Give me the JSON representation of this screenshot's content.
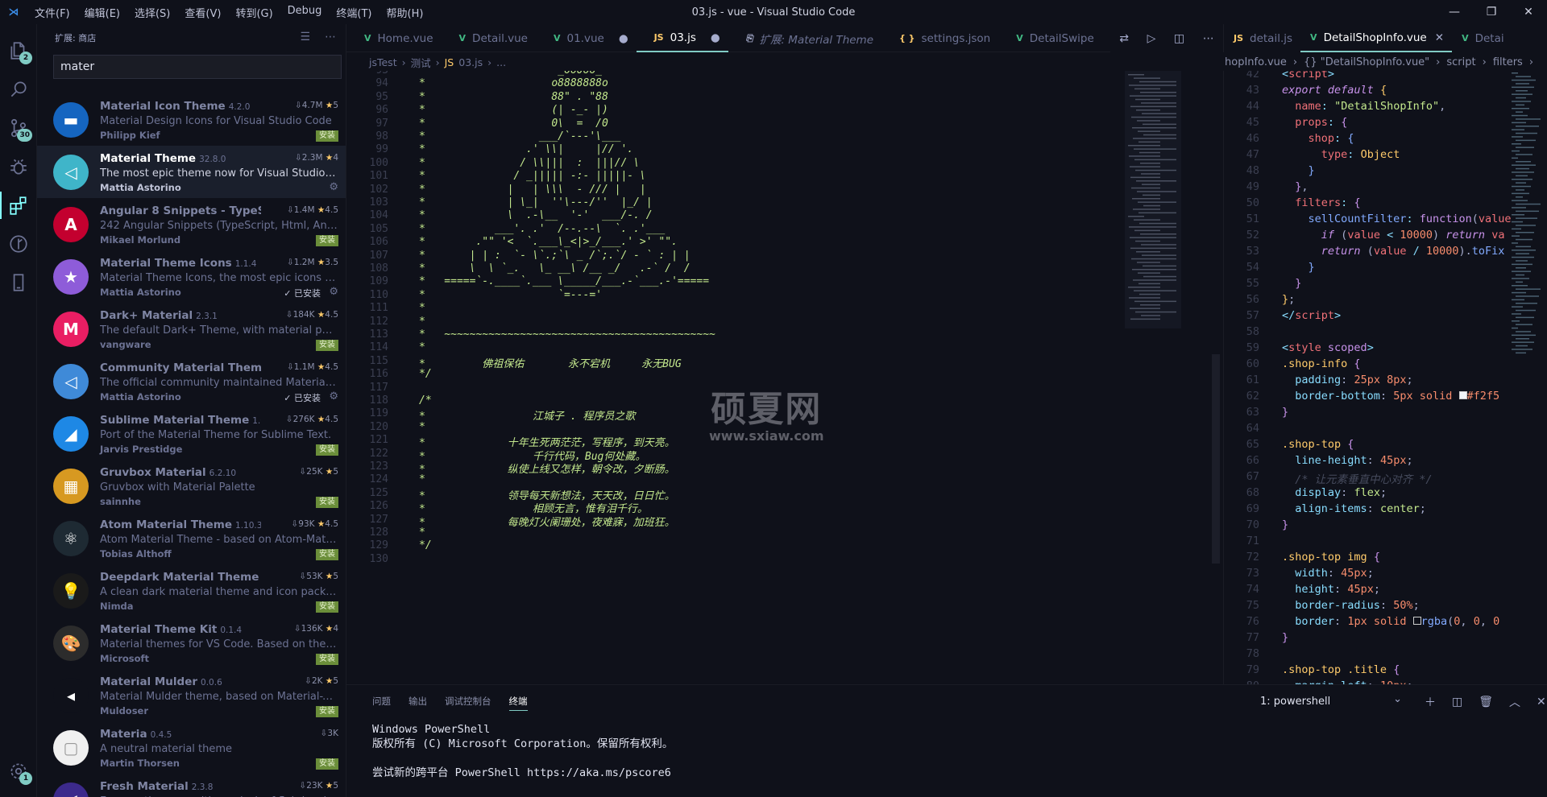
{
  "window": {
    "title": "03.js - vue - Visual Studio Code",
    "menu": [
      "文件(F)",
      "编辑(E)",
      "选择(S)",
      "查看(V)",
      "转到(G)",
      "Debug",
      "终端(T)",
      "帮助(H)"
    ],
    "controls": [
      "—",
      "❐",
      "✕"
    ]
  },
  "activity": {
    "explorer_badge": "2",
    "scm_badge": "30",
    "accounts_badge": "1"
  },
  "sidebar": {
    "title": "扩展: 商店",
    "search_value": "mater",
    "extensions": [
      {
        "name": "Material Icon Theme",
        "version": "4.2.0",
        "downloads": "4.7M",
        "rating": "5",
        "desc": "Material Design Icons for Visual Studio Code",
        "publisher": "Philipp Kief",
        "status": "安装",
        "icon_color": "#1565c0",
        "icon_glyph": "▬"
      },
      {
        "name": "Material Theme",
        "version": "32.8.0",
        "downloads": "2.3M",
        "rating": "4",
        "desc": "The most epic theme now for Visual Studio Code",
        "publisher": "Mattia Astorino",
        "status": "gear",
        "icon_color": "#3fb5c9",
        "icon_glyph": "◁"
      },
      {
        "name": "Angular 8 Snippets - TypeScr...",
        "version": "8.1.2",
        "downloads": "1.4M",
        "rating": "4.5",
        "desc": "242 Angular Snippets (TypeScript, Html, Angular ...",
        "publisher": "Mikael Morlund",
        "status": "安装",
        "icon_color": "#c3002f",
        "icon_glyph": "A"
      },
      {
        "name": "Material Theme Icons",
        "version": "1.1.4",
        "downloads": "1.2M",
        "rating": "3.5",
        "desc": "Material Theme Icons, the most epic icons theme...",
        "publisher": "Mattia Astorino",
        "status": "✓ 已安装",
        "icon_color": "#8e5cd9",
        "icon_glyph": "★"
      },
      {
        "name": "Dark+ Material",
        "version": "2.3.1",
        "downloads": "184K",
        "rating": "4.5",
        "desc": "The default Dark+ Theme, with material palette a...",
        "publisher": "vangware",
        "status": "安装",
        "icon_color": "#e91e63",
        "icon_glyph": "M"
      },
      {
        "name": "Community Material Theme",
        "version": "1.4.1",
        "downloads": "1.1M",
        "rating": "4.5",
        "desc": "The official community maintained Material The...",
        "publisher": "Mattia Astorino",
        "status": "✓ 已安装",
        "icon_color": "#3f8ad8",
        "icon_glyph": "◁"
      },
      {
        "name": "Sublime Material Theme",
        "version": "1.0.1",
        "downloads": "276K",
        "rating": "4.5",
        "desc": "Port of the Material Theme for Sublime Text.",
        "publisher": "Jarvis Prestidge",
        "status": "安装",
        "icon_color": "#1e88e5",
        "icon_glyph": "◢"
      },
      {
        "name": "Gruvbox Material",
        "version": "6.2.10",
        "downloads": "25K",
        "rating": "5",
        "desc": "Gruvbox with Material Palette",
        "publisher": "sainnhe",
        "status": "安装",
        "icon_color": "#d79921",
        "icon_glyph": "▦"
      },
      {
        "name": "Atom Material Theme",
        "version": "1.10.3",
        "downloads": "93K",
        "rating": "4.5",
        "desc": "Atom Material Theme - based on Atom-Material-...",
        "publisher": "Tobias Althoff",
        "status": "安装",
        "icon_color": "#1e2a33",
        "icon_glyph": "⚛"
      },
      {
        "name": "Deepdark Material Theme",
        "version": "3.2.1",
        "downloads": "53K",
        "rating": "5",
        "desc": "A clean dark material theme and icon package fo...",
        "publisher": "Nimda",
        "status": "安装",
        "icon_color": "#1a1a1a",
        "icon_glyph": "💡"
      },
      {
        "name": "Material Theme Kit",
        "version": "0.1.4",
        "downloads": "136K",
        "rating": "4",
        "desc": "Material themes for VS Code. Based on the Text...",
        "publisher": "Microsoft",
        "status": "安装",
        "icon_color": "#2c2c2c",
        "icon_glyph": "🎨"
      },
      {
        "name": "Material Mulder",
        "version": "0.0.6",
        "downloads": "2K",
        "rating": "5",
        "desc": "Material Mulder theme, based on Material-Theme",
        "publisher": "Muldoser",
        "status": "安装",
        "icon_color": "#0f111a",
        "icon_glyph": "◂"
      },
      {
        "name": "Materia",
        "version": "0.4.5",
        "downloads": "3K",
        "rating": "",
        "desc": "A neutral material theme",
        "publisher": "Martin Thorsen",
        "status": "安装",
        "icon_color": "#f0f0f0",
        "icon_glyph": "▢"
      },
      {
        "name": "Fresh Material",
        "version": "2.3.8",
        "downloads": "23K",
        "rating": "5",
        "desc": "Easy on the eyes with a splash of flair inspired by ...",
        "publisher": "",
        "status": "",
        "icon_color": "#3c2a8c",
        "icon_glyph": "◁"
      }
    ]
  },
  "editor1": {
    "tabs": [
      {
        "label": "Home.vue",
        "icon": "V",
        "icon_color": "#41b883",
        "dirty": ""
      },
      {
        "label": "Detail.vue",
        "icon": "V",
        "icon_color": "#41b883",
        "dirty": ""
      },
      {
        "label": "01.vue",
        "icon": "V",
        "icon_color": "#41b883",
        "dirty": "●"
      },
      {
        "label": "03.js",
        "icon": "JS",
        "icon_color": "#ffcb6b",
        "dirty": "●"
      },
      {
        "label": "扩展: Material Theme",
        "icon": "⎘",
        "icon_color": "#a6accd",
        "dirty": ""
      },
      {
        "label": "settings.json",
        "icon": "{ }",
        "icon_color": "#ffcb6b",
        "dirty": ""
      },
      {
        "label": "DetailSwipe",
        "icon": "V",
        "icon_color": "#41b883",
        "dirty": ""
      }
    ],
    "breadcrumb": [
      "jsTest",
      "›",
      "测试",
      "›",
      "JS",
      "03.js",
      "›",
      "..."
    ],
    "first_line": 93,
    "lines": [
      "*                     _oo0oo_",
      "*                    o8888888o",
      "*                    88\" . \"88",
      "*                    (| -_- |)",
      "*                    0\\  =  /0",
      "*                  ___/`---'\\___",
      "*                .' \\\\|     |// '.",
      "*               / \\\\|||  :  |||// \\",
      "*              / _||||| -:- |||||- \\",
      "*             |   | \\\\\\  - /// |   |",
      "*             | \\_|  ''\\---/''  |_/ |",
      "*             \\  .-\\__  '-'  ___/-. /",
      "*           ___'. .'  /--.--\\  `. .'___",
      "*        .\"\" '<  `.___\\_<|>_/___.' >' \"\".",
      "*       | | :  `- \\`.;`\\ _ /`;.`/ - ` : | |",
      "*       \\  \\ `_.   \\_ __\\ /__ _/   .-` /  /",
      "*   =====`-.____`.___ \\_____/___.-`___.-'=====",
      "*                     `=---='",
      "*",
      "*",
      "*   ~~~~~~~~~~~~~~~~~~~~~~~~~~~~~~~~~~~~~~~~~~~",
      "*",
      "*         佛祖保佑       永不宕机     永无BUG",
      "*/",
      "",
      "/*",
      "*                 江城子 . 程序员之歌",
      "*",
      "*             十年生死两茫茫，写程序，到天亮。",
      "*                 千行代码，Bug何处藏。",
      "*             纵使上线又怎样，朝令改，夕断肠。",
      "*",
      "*             领导每天新想法，天天改，日日忙。",
      "*                 相顾无言，惟有泪千行。",
      "*             每晚灯火阑珊处，夜难寐，加班狂。",
      "*",
      "*/",
      ""
    ]
  },
  "watermark": {
    "big": "硕夏网",
    "small": "www.sxiaw.com"
  },
  "editor2": {
    "tabs": [
      {
        "label": "detail.js",
        "icon": "JS",
        "icon_color": "#ffcb6b",
        "active": false
      },
      {
        "label": "DetailShopInfo.vue",
        "icon": "V",
        "icon_color": "#41b883",
        "active": true,
        "close": "✕"
      },
      {
        "label": "Detai",
        "icon": "V",
        "icon_color": "#41b883",
        "active": false
      }
    ],
    "breadcrumb": [
      "hopInfo.vue",
      "›",
      "{} \"DetailShopInfo.vue\"",
      "›",
      "script",
      "›",
      "filters",
      "›"
    ],
    "first_line": 42
  },
  "panel": {
    "tabs": [
      "问题",
      "输出",
      "调试控制台",
      "终端"
    ],
    "active_tab": "终端",
    "terminal_select": "1: powershell",
    "terminal_lines": [
      "Windows PowerShell",
      "版权所有 (C) Microsoft Corporation。保留所有权利。",
      "",
      "尝试新的跨平台 PowerShell https://aka.ms/pscore6"
    ]
  }
}
